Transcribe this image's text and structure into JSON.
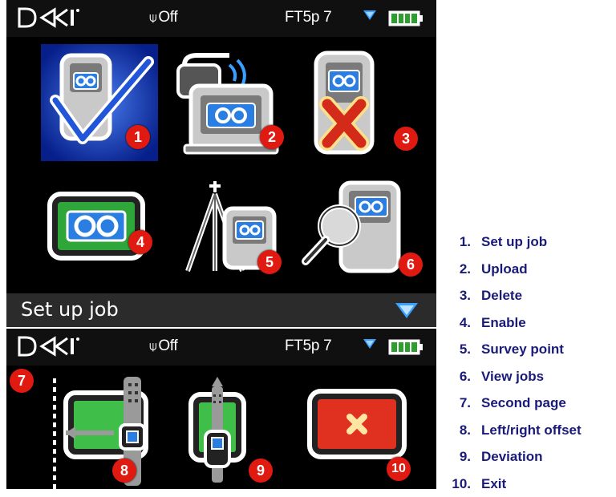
{
  "status": {
    "logo": "DCI",
    "signal_label": "Off",
    "frequency_label": "FT5p 7"
  },
  "screen1": {
    "badges": [
      "1",
      "2",
      "3",
      "4",
      "5",
      "6"
    ],
    "bottom_title": "Set up job"
  },
  "screen2": {
    "page_badge": "7",
    "badges": [
      "8",
      "9",
      "10"
    ]
  },
  "legend": [
    {
      "num": "1.",
      "label": "Set up job"
    },
    {
      "num": "2.",
      "label": "Upload"
    },
    {
      "num": "3.",
      "label": "Delete"
    },
    {
      "num": "4.",
      "label": "Enable"
    },
    {
      "num": "5.",
      "label": "Survey point"
    },
    {
      "num": "6.",
      "label": "View jobs"
    },
    {
      "num": "7.",
      "label": "Second page"
    },
    {
      "num": "8.",
      "label": "Left/right offset"
    },
    {
      "num": "9.",
      "label": "Deviation"
    },
    {
      "num": "10.",
      "label": "Exit"
    }
  ],
  "colors": {
    "badge": "#e01a10",
    "legend_text": "#1a1a7a",
    "selected_tile": "#0a2a9a",
    "tape_blue": "#2a7de1",
    "green_screen": "#2ea63a",
    "exit_red": "#e03020"
  }
}
